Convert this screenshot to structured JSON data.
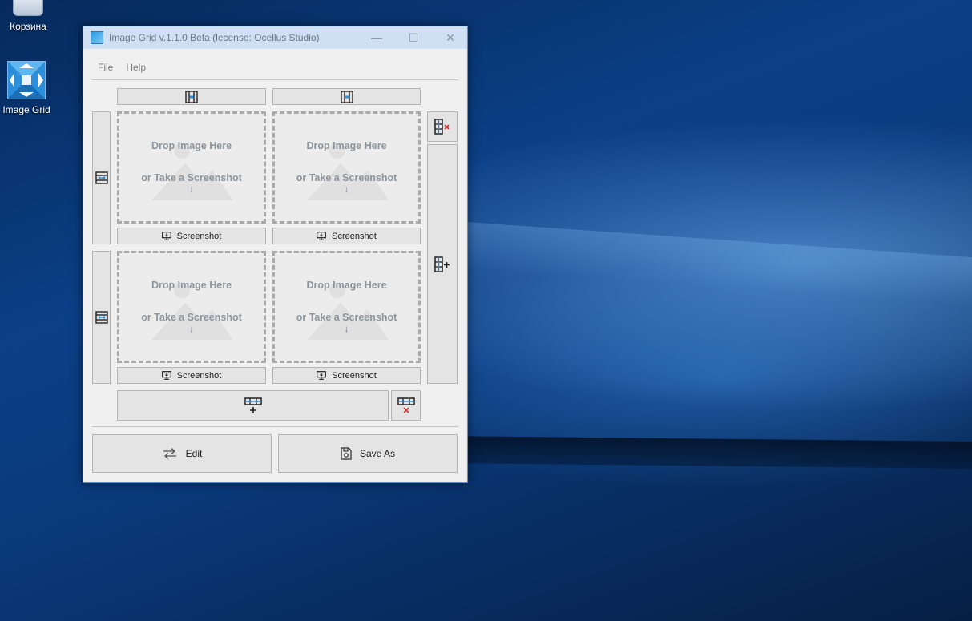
{
  "desktop": {
    "icons": [
      {
        "label": "Корзина",
        "icon": "recycle-bin-icon"
      },
      {
        "label": "Image Grid",
        "icon": "image-grid-app-icon"
      }
    ]
  },
  "window": {
    "title": "Image Grid v.1.1.0 Beta   (lecense: Ocellus Studio)",
    "controls": {
      "minimize": "—",
      "maximize": "☐",
      "close": "✕"
    }
  },
  "menu": {
    "file": "File",
    "help": "Help"
  },
  "grid": {
    "cells": [
      {
        "drop_line1": "Drop Image Here",
        "drop_line2": "or Take a Screenshot",
        "arrow": "↓",
        "screenshot_label": "Screenshot"
      },
      {
        "drop_line1": "Drop Image Here",
        "drop_line2": "or Take a Screenshot",
        "arrow": "↓",
        "screenshot_label": "Screenshot"
      },
      {
        "drop_line1": "Drop Image Here",
        "drop_line2": "or Take a Screenshot",
        "arrow": "↓",
        "screenshot_label": "Screenshot"
      },
      {
        "drop_line1": "Drop Image Here",
        "drop_line2": "or Take a Screenshot",
        "arrow": "↓",
        "screenshot_label": "Screenshot"
      }
    ]
  },
  "footer": {
    "edit_label": "Edit",
    "save_label": "Save As"
  },
  "colors": {
    "accent": "#1f88d8",
    "remove": "#d0312d",
    "titlebar": "#cfe0f4"
  }
}
